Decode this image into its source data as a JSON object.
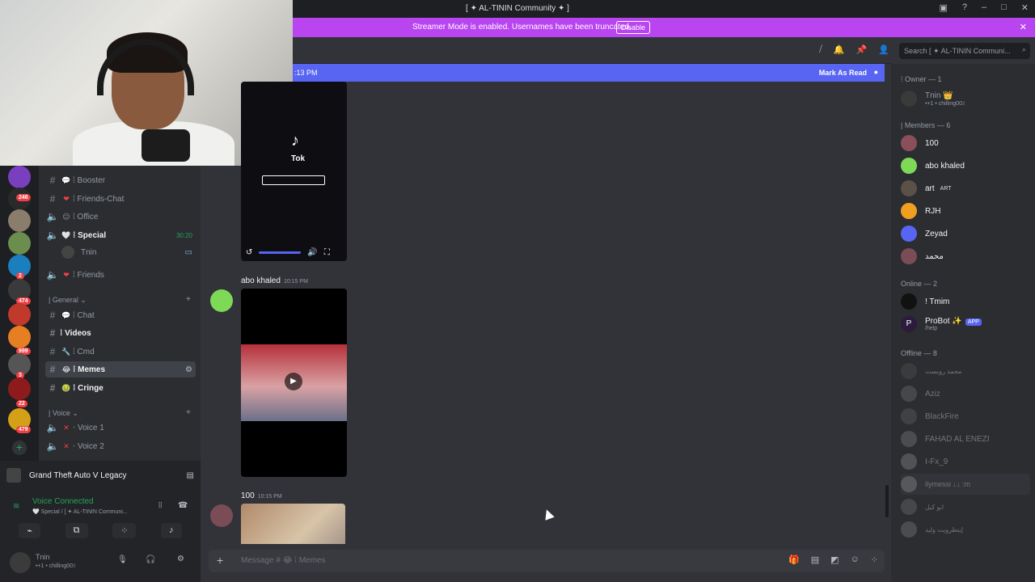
{
  "window": {
    "title": "[ ✦ AL-TININ Community ✦ ]"
  },
  "banner": {
    "message": "Streamer Mode is enabled. Usernames have been truncated.",
    "button": "Disable"
  },
  "newbar": {
    "time": ":13 PM",
    "action": "Mark As Read"
  },
  "servers": {
    "badges": [
      "246",
      "2",
      "474",
      "999",
      "3",
      "22",
      "479"
    ]
  },
  "channels": {
    "items": [
      {
        "label": "⁞ Booster",
        "kind": "text",
        "emoji": "💬"
      },
      {
        "label": "⁞ Friends-Chat",
        "kind": "text",
        "emoji": "❤"
      },
      {
        "label": "⁞ Office",
        "kind": "voice",
        "emoji": "😐"
      },
      {
        "label": "⁞ Special",
        "kind": "voice",
        "emoji": "🤍",
        "time": "30:20"
      },
      {
        "label": "Tnin",
        "kind": "user"
      },
      {
        "label": "⁞ Friends",
        "kind": "voice",
        "emoji": "❤"
      }
    ],
    "category_general": "| General",
    "general": [
      {
        "label": "⁞ Chat",
        "emoji": "💬"
      },
      {
        "label": "⁞ Videos",
        "emoji": ""
      },
      {
        "label": "⁞ Cmd",
        "emoji": "🔧"
      },
      {
        "label": "⁞ Memes",
        "emoji": "😂"
      },
      {
        "label": "⁞ Cringe",
        "emoji": "🤢"
      }
    ],
    "category_voice": "| Voice",
    "voice": [
      {
        "label": "⋅ Voice 1"
      },
      {
        "label": "⋅ Voice 2"
      }
    ]
  },
  "activity": {
    "game": "Grand Theft Auto V Legacy"
  },
  "voice_status": {
    "title": "Voice Connected",
    "detail": "🤍 Special / [ ✦ AL-TININ Communi..."
  },
  "user": {
    "name": "Tnin",
    "status": "•+1 • chilling00٪"
  },
  "messages": [
    {
      "author": "abo khaled",
      "time": "10:15 PM"
    },
    {
      "author": "100",
      "time": "10:15 PM"
    }
  ],
  "tiktok_label": "Tok",
  "composer": {
    "placeholder": "Message # 😂 ⁞ Memes"
  },
  "search": {
    "placeholder": "Search [ ✦ AL-TININ Communi..."
  },
  "members": {
    "owner_header": "⁞ Owner — 1",
    "owner": {
      "name": "Tnin 👑",
      "status": "•+1 • chilling00٪"
    },
    "members_header": "| Members — 6",
    "members": [
      {
        "name": "100"
      },
      {
        "name": "abo khaled"
      },
      {
        "name": "art",
        "tag": "ART"
      },
      {
        "name": "RJH"
      },
      {
        "name": "Zeyad"
      },
      {
        "name": "محمد"
      }
    ],
    "online_header": "Online — 2",
    "online": [
      {
        "name": "! Tmim"
      },
      {
        "name": "ProBot ✨",
        "tag": "APP",
        "status": "/help"
      }
    ],
    "offline_header": "Offline — 8",
    "offline": [
      {
        "name": "محمد رويست"
      },
      {
        "name": "Aziz"
      },
      {
        "name": "BlackFire"
      },
      {
        "name": "FAHAD AL ENEZI"
      },
      {
        "name": "I-Fx_9"
      },
      {
        "name": "ilymessi ↓↓ :m"
      },
      {
        "name": "ابو كبل"
      },
      {
        "name": "إينطرويت وليد"
      }
    ]
  },
  "colors": {
    "accent": "#5865f2",
    "streamer": "#b845f0",
    "online": "#23a55a"
  }
}
